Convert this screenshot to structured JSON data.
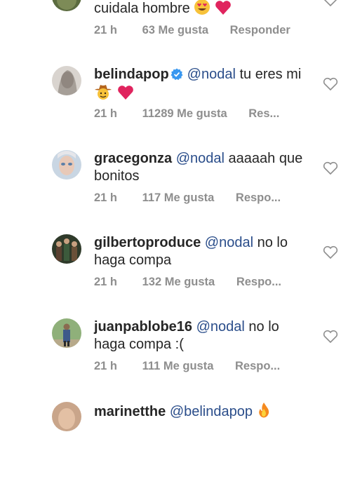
{
  "comments": [
    {
      "username": "",
      "mention": "",
      "text": "cuidala hombre",
      "time": "21 h",
      "likes": "63 Me gusta",
      "reply": "Responder"
    },
    {
      "username": "belindapop",
      "mention": "@nodal",
      "text": "tu eres mi",
      "time": "21 h",
      "likes": "11289 Me gusta",
      "reply": "Res..."
    },
    {
      "username": "gracegonza",
      "mention": "@nodal",
      "text": "aaaaah que",
      "text2": "bonitos",
      "time": "21 h",
      "likes": "117 Me gusta",
      "reply": "Respo..."
    },
    {
      "username": "gilbertoproduce",
      "mention": "@nodal",
      "text": "no lo",
      "text2": "haga compa",
      "time": "21 h",
      "likes": "132 Me gusta",
      "reply": "Respo..."
    },
    {
      "username": "juanpablobe16",
      "mention": "@nodal",
      "text": "no lo",
      "text2": "haga compa :(",
      "time": "21 h",
      "likes": "111 Me gusta",
      "reply": "Respo..."
    },
    {
      "username": "marinetthe",
      "mention": "@belindapop",
      "text": "",
      "time": "",
      "likes": "",
      "reply": ""
    }
  ],
  "colors": {
    "text": "#262626",
    "meta": "#8e8e8e",
    "mention": "#2a4d8a",
    "verified": "#3897f0",
    "heart_emoji": "#e0245e"
  },
  "icons": [
    "heart-eyes-emoji",
    "red-heart-emoji",
    "verified-badge-icon",
    "cowboy-emoji",
    "fire-emoji",
    "heart-outline-icon"
  ]
}
